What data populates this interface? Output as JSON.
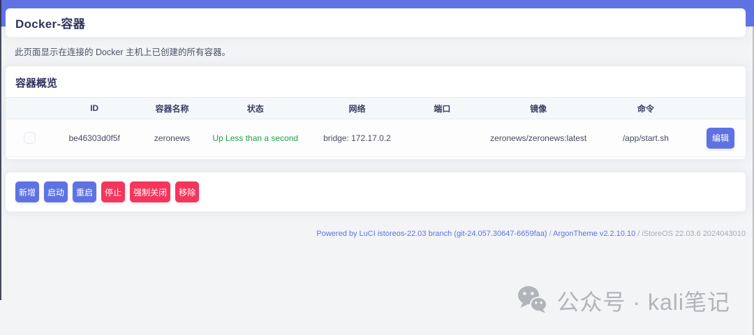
{
  "header": {
    "title": "Docker-容器"
  },
  "intro": {
    "text": "此页面显示在连接的 Docker 主机上已创建的所有容器。"
  },
  "overview": {
    "title": "容器概览",
    "columns": [
      "ID",
      "容器名称",
      "状态",
      "网络",
      "端口",
      "镜像",
      "命令"
    ],
    "rows": [
      {
        "id": "be46303d0f5f",
        "name": "zeronews",
        "status": "Up Less than a second",
        "network": "bridge: 172.17.0.2",
        "ports": "",
        "image": "zeronews/zeronews:latest",
        "command": "/app/start.sh",
        "edit_label": "编辑"
      }
    ]
  },
  "actions": {
    "add": "新增",
    "start": "启动",
    "restart": "重启",
    "stop": "停止",
    "force_close": "强制关闭",
    "remove": "移除"
  },
  "footer": {
    "powered": "Powered by LuCI istoreos-22.03 branch (git-24.057.30647-6659faa)",
    "sep1": " / ",
    "theme": "ArgonTheme v2.2.10.10",
    "sep2": " / ",
    "firmware": "iStoreOS 22.03.6 2024043010"
  },
  "watermark": {
    "icon": "wechat-icon",
    "text": "公众号 · kali笔记"
  },
  "colors": {
    "primary": "#5e72e4",
    "danger": "#f5365c",
    "success_text": "#1da14a",
    "heading": "#32325d",
    "page_bg": "#f3f4f6",
    "table_head_bg": "#f5f8fb",
    "watermark_gray": "#b1b4b8"
  }
}
